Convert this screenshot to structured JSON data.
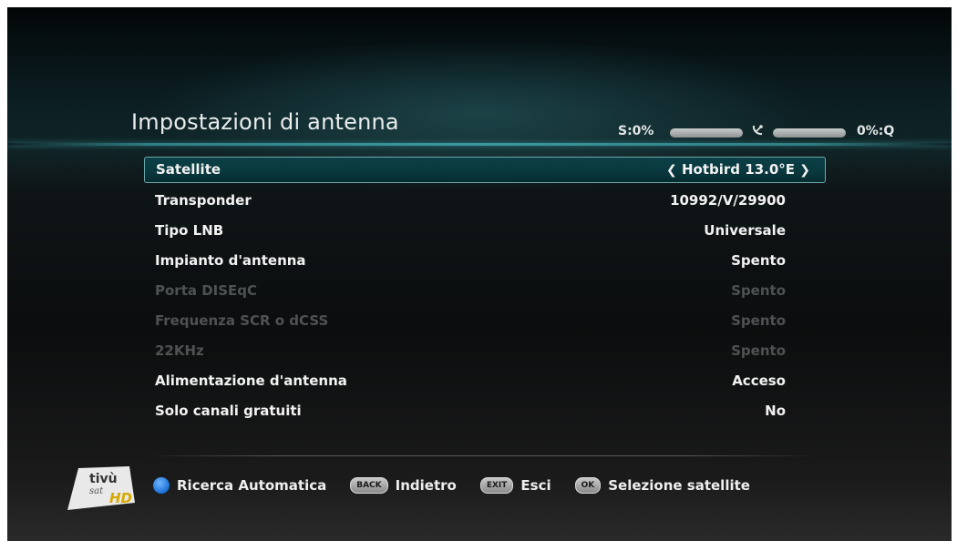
{
  "screen": {
    "title": "Impostazioni di antenna"
  },
  "signal": {
    "strength_label": "S:0%",
    "quality_label": "0%:Q",
    "strength_level_percent": 0,
    "quality_level_percent": 0,
    "tuning_icon": "satellite-dish-icon"
  },
  "menu": {
    "items": [
      {
        "label": "Satellite",
        "value": "Hotbird 13.0°E",
        "state": "selected"
      },
      {
        "label": "Transponder",
        "value": "10992/V/29900",
        "state": "enabled"
      },
      {
        "label": "Tipo LNB",
        "value": "Universale",
        "state": "enabled"
      },
      {
        "label": "Impianto d'antenna",
        "value": "Spento",
        "state": "enabled"
      },
      {
        "label": "Porta DISEqC",
        "value": "Spento",
        "state": "disabled"
      },
      {
        "label": "Frequenza SCR o dCSS",
        "value": "Spento",
        "state": "disabled"
      },
      {
        "label": "22KHz",
        "value": "Spento",
        "state": "disabled"
      },
      {
        "label": "Alimentazione d'antenna",
        "value": "Acceso",
        "state": "enabled"
      },
      {
        "label": "Solo canali gratuiti",
        "value": "No",
        "state": "enabled"
      }
    ],
    "left_arrow": "❮",
    "right_arrow": "❯"
  },
  "legend": {
    "blue_label": "Ricerca Automatica",
    "back_key": "BACK",
    "back_label": "Indietro",
    "exit_key": "EXIT",
    "exit_label": "Esci",
    "ok_key": "OK",
    "ok_label": "Selezione satellite"
  },
  "logo": {
    "text_top": "tivù",
    "text_bottom": "sat",
    "badge": "HD"
  },
  "colors": {
    "accent": "#3b9aa0",
    "selected_bg": "#0a3a40",
    "disabled_text": "#4f5252",
    "blue_button": "#1a6fd6"
  }
}
